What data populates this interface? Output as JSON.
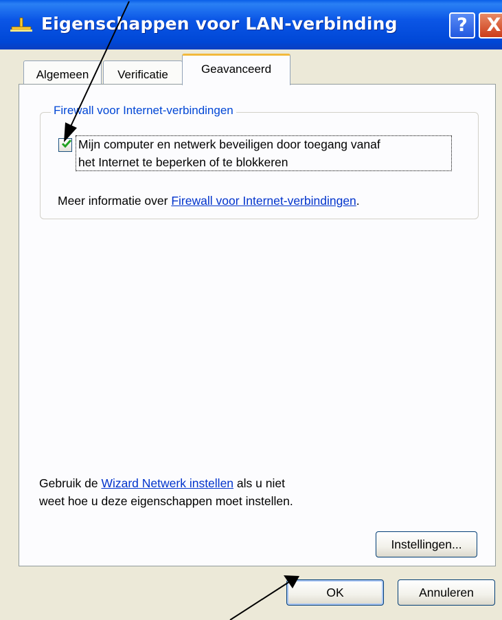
{
  "window": {
    "title": "Eigenschappen voor LAN-verbinding",
    "help_label": "?",
    "close_label": "X"
  },
  "tabs": [
    {
      "label": "Algemeen",
      "active": false
    },
    {
      "label": "Verificatie",
      "active": false
    },
    {
      "label": "Geavanceerd",
      "active": true
    }
  ],
  "firewall_group": {
    "title": "Firewall voor Internet-verbindingen",
    "checkbox_checked": true,
    "checkbox_label_line1": "Mijn computer en netwerk beveiligen door toegang vanaf",
    "checkbox_label_line2": "het Internet te beperken of te blokkeren",
    "info_prefix": "Meer informatie over ",
    "info_link": "Firewall voor Internet-verbindingen",
    "info_suffix": "."
  },
  "wizard": {
    "prefix": "Gebruik de ",
    "link": "Wizard Netwerk instellen",
    "suffix": " als u niet",
    "line2": "weet hoe u deze eigenschappen moet instellen."
  },
  "buttons": {
    "instellingen": "Instellingen...",
    "ok": "OK",
    "annuleren": "Annuleren"
  },
  "colors": {
    "titlebar": "#0a56e6",
    "face": "#ece9d8",
    "link": "#0033cc",
    "group_title": "#0046d5",
    "check": "#21a121",
    "active_tab_accent": "#f2b93c"
  }
}
